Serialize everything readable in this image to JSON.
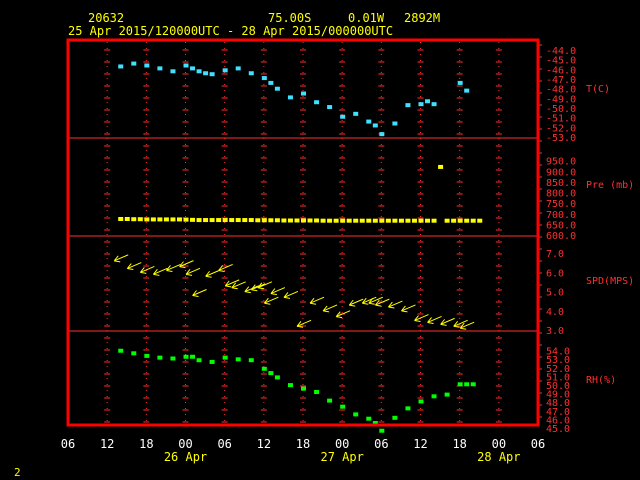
{
  "header": {
    "station": "20632",
    "lat": "75.00S",
    "lon": "0.01W",
    "elev": "2892M",
    "range": "25 Apr 2015/120000UTC - 28 Apr 2015/000000UTC"
  },
  "page_number": "2",
  "colors": {
    "frame": "#ff0000",
    "grid": "#ff3030",
    "temp": "#40e0ff",
    "pressure": "#ffff00",
    "wind": "#ffff00",
    "rh": "#00ff00",
    "header": "#ffff00",
    "x_ticks": "#ffffff"
  },
  "chart_data": [
    {
      "type": "scatter",
      "label": "T(C)",
      "ylim": [
        -53,
        -44
      ],
      "yticks": [
        -44.0,
        -45.0,
        -46.0,
        -47.0,
        -48.0,
        -49.0,
        -50.0,
        -51.0,
        -52.0,
        -53.0
      ],
      "x_hours": [
        14,
        16,
        18,
        20,
        22,
        24,
        25,
        26,
        27,
        28,
        30,
        32,
        34,
        36,
        37,
        38,
        40,
        42,
        44,
        46,
        48,
        50,
        52,
        53,
        54,
        56,
        58,
        60,
        61,
        62,
        66,
        67
      ],
      "y": [
        -45.6,
        -45.3,
        -45.5,
        -45.8,
        -46.1,
        -45.5,
        -45.8,
        -46.1,
        -46.3,
        -46.4,
        -46.0,
        -45.8,
        -46.3,
        -46.8,
        -47.3,
        -47.9,
        -48.8,
        -48.4,
        -49.3,
        -49.8,
        -50.8,
        -50.5,
        -51.3,
        -51.7,
        -52.6,
        -51.5,
        -49.6,
        -49.5,
        -49.2,
        -49.5,
        -47.3,
        -48.1
      ]
    },
    {
      "type": "scatter",
      "label": "Pre (mb)",
      "ylim": [
        600,
        1000
      ],
      "yticks": [
        950.0,
        900.0,
        850.0,
        800.0,
        750.0,
        700.0,
        650.0,
        600.0
      ],
      "x_hours": [
        14,
        15,
        16,
        17,
        18,
        19,
        20,
        21,
        22,
        23,
        24,
        25,
        26,
        27,
        28,
        29,
        30,
        31,
        32,
        33,
        34,
        35,
        36,
        37,
        38,
        39,
        40,
        41,
        42,
        43,
        44,
        45,
        46,
        47,
        48,
        49,
        50,
        51,
        52,
        53,
        54,
        55,
        56,
        57,
        58,
        59,
        60,
        61,
        62,
        63,
        64,
        65,
        66,
        67,
        68,
        69
      ],
      "y": [
        680,
        680,
        679,
        679,
        678,
        678,
        678,
        678,
        678,
        678,
        677,
        676,
        675,
        675,
        675,
        675,
        675,
        675,
        675,
        675,
        675,
        674,
        674,
        674,
        674,
        673,
        673,
        673,
        673,
        673,
        673,
        672,
        672,
        672,
        672,
        672,
        672,
        672,
        672,
        672,
        672,
        672,
        672,
        672,
        672,
        672,
        672,
        672,
        672,
        925,
        672,
        672,
        672,
        672,
        672,
        672
      ]
    },
    {
      "type": "scatter",
      "label": "SPD(MPS)",
      "ylim": [
        3,
        7
      ],
      "yticks": [
        7.0,
        6.0,
        5.0,
        4.0,
        3.0
      ],
      "x_hours": [
        14,
        16,
        18,
        20,
        22,
        24,
        25,
        26,
        28,
        30,
        31,
        32,
        34,
        35,
        36,
        37,
        38,
        40,
        42,
        44,
        46,
        48,
        50,
        52,
        53,
        54,
        56,
        58,
        60,
        62,
        64,
        66,
        67
      ],
      "y": [
        6.8,
        6.4,
        6.2,
        6.1,
        6.3,
        6.5,
        6.1,
        5.0,
        6.0,
        6.3,
        5.5,
        5.4,
        5.2,
        5.3,
        5.4,
        4.6,
        5.1,
        4.9,
        3.4,
        4.6,
        4.2,
        3.9,
        4.5,
        4.6,
        4.6,
        4.5,
        4.4,
        4.2,
        3.7,
        3.6,
        3.5,
        3.4,
        3.3
      ]
    },
    {
      "type": "scatter",
      "label": "RH(%)",
      "ylim": [
        45,
        55
      ],
      "yticks": [
        54.0,
        53.0,
        52.0,
        51.0,
        50.0,
        49.0,
        48.0,
        47.0,
        46.0,
        45.0
      ],
      "x_hours": [
        14,
        16,
        18,
        20,
        22,
        24,
        25,
        26,
        28,
        30,
        32,
        34,
        36,
        37,
        38,
        40,
        42,
        44,
        46,
        48,
        50,
        52,
        53,
        54,
        56,
        58,
        60,
        62,
        64,
        66,
        67,
        68
      ],
      "y": [
        54.1,
        53.8,
        53.5,
        53.3,
        53.2,
        53.4,
        53.4,
        53.0,
        52.8,
        53.3,
        53.1,
        53.0,
        52.0,
        51.5,
        51.0,
        50.1,
        49.7,
        49.3,
        48.3,
        47.6,
        46.7,
        46.2,
        45.7,
        44.8,
        46.3,
        47.4,
        48.2,
        48.8,
        49.0,
        50.2,
        50.2,
        50.2
      ]
    }
  ],
  "x_axis": {
    "hour_labels": [
      "06",
      "12",
      "18",
      "00",
      "06",
      "12",
      "18",
      "00",
      "06",
      "12",
      "18",
      "00",
      "06"
    ],
    "date_labels": [
      {
        "text": "26 Apr",
        "hour": 24
      },
      {
        "text": "27 Apr",
        "hour": 48
      },
      {
        "text": "28 Apr",
        "hour": 72
      }
    ]
  }
}
